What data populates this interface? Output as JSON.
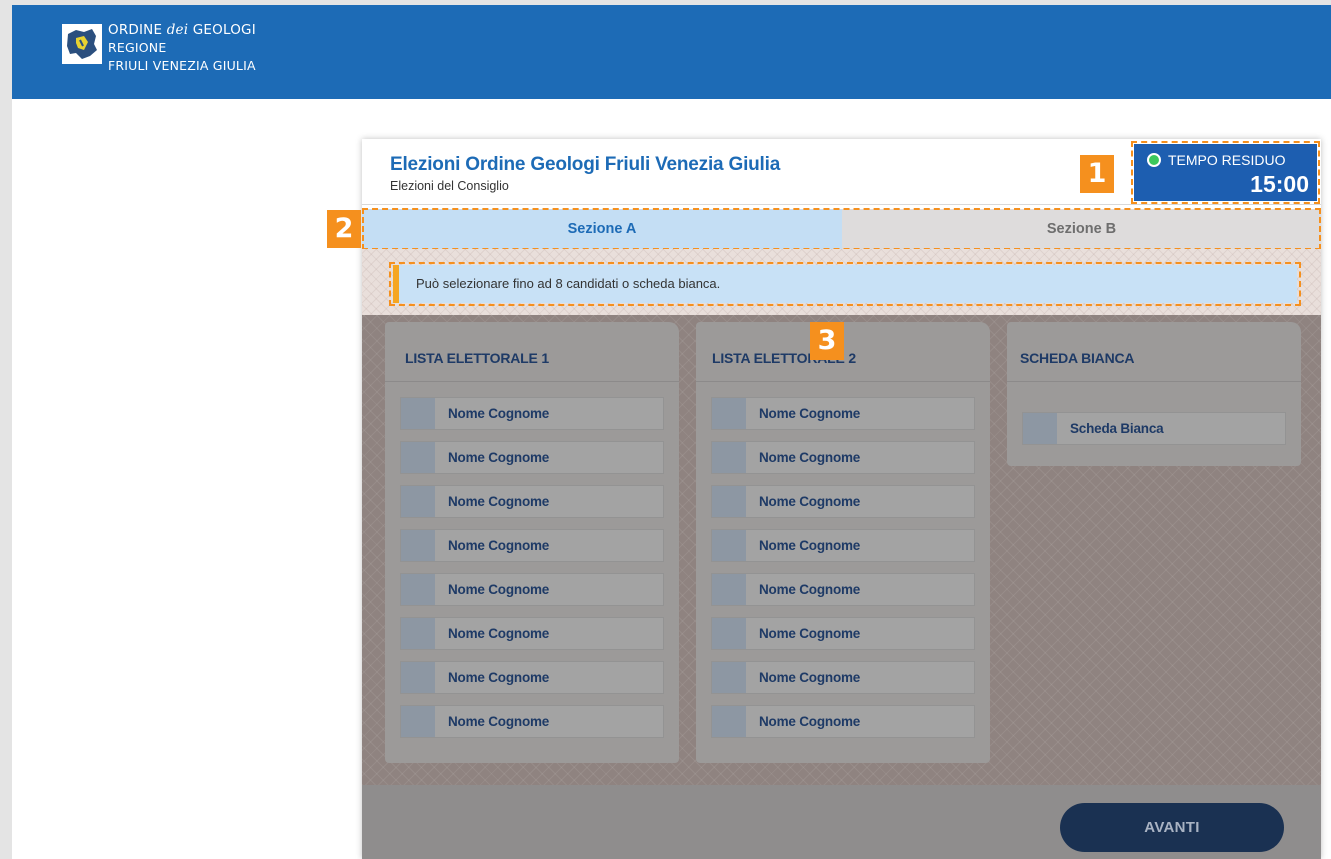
{
  "brand": {
    "line1_a": "ORDINE ",
    "line1_b": "dei",
    "line1_c": " GEOLOGI",
    "line2": "REGIONE",
    "line3": "FRIULI VENEZIA GIULIA"
  },
  "election": {
    "title": "Elezioni Ordine Geologi Friuli Venezia Giulia",
    "subtitle": "Elezioni del Consiglio"
  },
  "timer": {
    "label": "TEMPO RESIDUO",
    "value": "15:00",
    "status_color": "#3cc95c"
  },
  "tabs": [
    {
      "label": "Sezione A",
      "active": true
    },
    {
      "label": "Sezione B",
      "active": false
    }
  ],
  "notice": "Può selezionare fino ad 8 candidati o scheda bianca.",
  "lists": [
    {
      "title": "LISTA ELETTORALE 1",
      "candidates": [
        "Nome Cognome",
        "Nome Cognome",
        "Nome Cognome",
        "Nome Cognome",
        "Nome Cognome",
        "Nome Cognome",
        "Nome Cognome",
        "Nome Cognome"
      ]
    },
    {
      "title": "LISTA ELETTORALE 2",
      "candidates": [
        "Nome Cognome",
        "Nome Cognome",
        "Nome Cognome",
        "Nome Cognome",
        "Nome Cognome",
        "Nome Cognome",
        "Nome Cognome",
        "Nome Cognome"
      ]
    },
    {
      "title": "SCHEDA BIANCA",
      "candidates": [
        "Scheda Bianca"
      ]
    }
  ],
  "annotations": [
    "1",
    "2",
    "3"
  ],
  "actions": {
    "next_label": "AVANTI"
  },
  "colors": {
    "brand_blue": "#1d6bb6",
    "annotation_orange": "#f5901e",
    "notice_accent": "#f5a623"
  }
}
